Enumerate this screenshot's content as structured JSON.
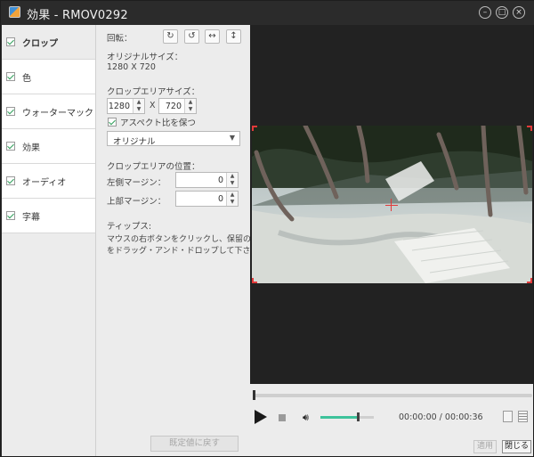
{
  "window": {
    "title": "効果 - RMOV0292",
    "minimize_glyph": "–",
    "maximize_glyph": "□",
    "close_glyph": "×"
  },
  "sidebar": {
    "items": [
      {
        "label": "クロップ",
        "checked": true,
        "active": true
      },
      {
        "label": "色",
        "checked": true,
        "active": false
      },
      {
        "label": "ウォーターマック",
        "checked": true,
        "active": false
      },
      {
        "label": "効果",
        "checked": true,
        "active": false
      },
      {
        "label": "オーディオ",
        "checked": true,
        "active": false
      },
      {
        "label": "字幕",
        "checked": true,
        "active": false
      }
    ]
  },
  "crop": {
    "rotate_label": "回転：",
    "rotate_icons": [
      "rotate-cw-icon",
      "rotate-ccw-icon",
      "flip-horizontal-icon",
      "flip-vertical-icon"
    ],
    "original_size_label": "オリジナルサイズ：",
    "original_size_value": "1280 X 720",
    "crop_area_size_label": "クロップエリアサイズ：",
    "width_value": "1280",
    "x_label": "X",
    "height_value": "720",
    "keep_aspect_label": "アスペクト比を保つ",
    "keep_aspect_checked": true,
    "aspect_select_value": "オリジナル",
    "position_label": "クロップエリアの位置：",
    "left_margin_label": "左側マージン：",
    "left_margin_value": "0",
    "top_margin_label": "上部マージン：",
    "top_margin_value": "0",
    "tips_label": "ティップス:",
    "tips_line1": "マウスの右ボタンをクリックし、保留の部分",
    "tips_line2": "をドラッグ・アンド・ドロップして下さい。",
    "reset_label": "既定値に戻す"
  },
  "player": {
    "time_text": "00:00:00 / 00:00:36",
    "seek_progress": 0.0,
    "volume_level": 0.7
  },
  "footer": {
    "apply_label": "適用",
    "close_label": "閉じる"
  },
  "colors": {
    "accent": "#3ec39b",
    "crop_marker": "#e23a3a",
    "preview_bg": "#222222",
    "titlebar_bg": "#2b2b2b"
  }
}
